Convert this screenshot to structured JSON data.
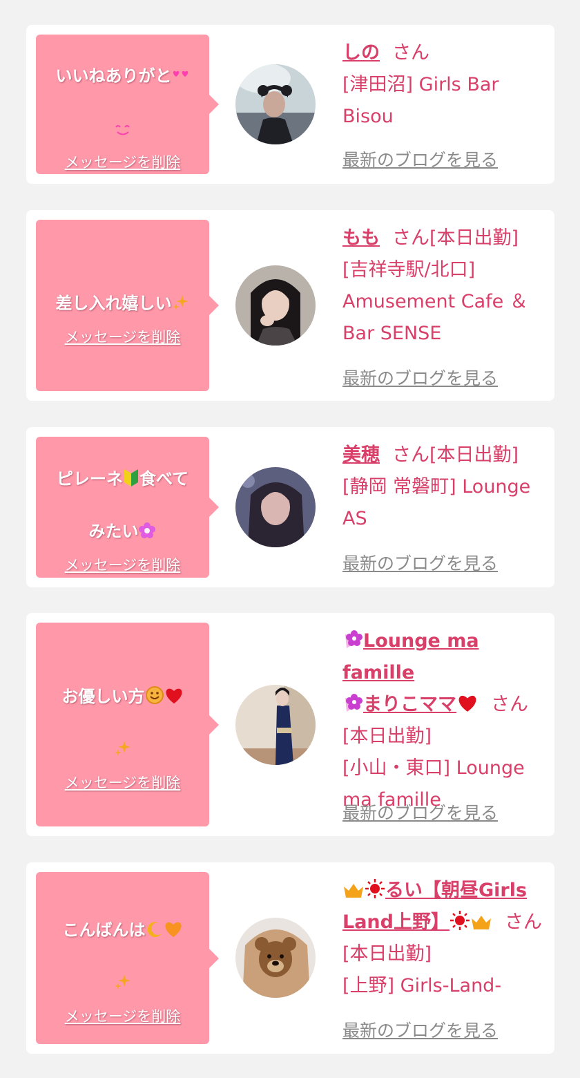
{
  "entries": [
    {
      "message": "いいねありがと",
      "delete_label": "メッセージを削除",
      "name": "しの",
      "suffix": "さん",
      "shop": "[津田沼] Girls Bar Bisou",
      "blog_label": "最新のブログを見る"
    },
    {
      "message": "差し入れ嬉しい",
      "delete_label": "メッセージを削除",
      "name": "もも",
      "suffix": "さん[本日出勤]",
      "shop": "[吉祥寺駅/北口] Amusement Cafe ＆Bar SENSE",
      "blog_label": "最新のブログを見る"
    },
    {
      "message_line1": "ピレーネ",
      "message_line1b": "食べて",
      "message_line2": "みたい",
      "delete_label": "メッセージを削除",
      "name": "美穂",
      "suffix": "さん[本日出勤]",
      "shop": "[静岡 常磐町] Lounge AS",
      "blog_label": "最新のブログを見る"
    },
    {
      "message": "お優しい方",
      "delete_label": "メッセージを削除",
      "name_line1": "Lounge ma famille",
      "name_line2": "まりこママ",
      "suffix": "さん[本日出勤]",
      "shop": "[小山・東口] Lounge ma famille",
      "blog_label": "最新のブログを見る"
    },
    {
      "message": "こんばんは",
      "delete_label": "メッセージを削除",
      "name_line1": "るい【朝昼Girls",
      "name_line2": "Land上野】",
      "suffix": "さん[本日出勤]",
      "shop": "[上野] Girls-Land-",
      "blog_label": "最新のブログを見る"
    }
  ],
  "colors": {
    "background": "#f2f2f2",
    "card": "#ffffff",
    "bubble": "#ff99aa",
    "accent_text": "#d8406a",
    "link_gray": "#8a8a8a"
  },
  "icons": [
    "heart-eyes-icon",
    "sparkles-icon",
    "beginner-mark-icon",
    "flower-icon",
    "smiley-icon",
    "red-heart-icon",
    "moon-icon",
    "orange-heart-icon",
    "crown-icon",
    "sun-icon"
  ]
}
